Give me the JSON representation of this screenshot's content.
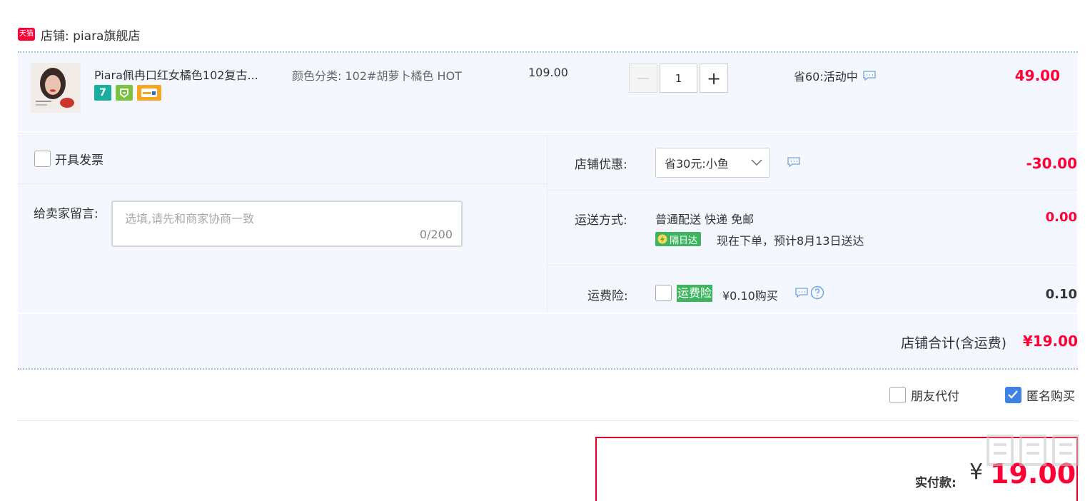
{
  "shop": {
    "logo_text": "天猫",
    "label": "店铺: piara旗舰店"
  },
  "item": {
    "title": "Piara佩冉口红女橘色102复古...",
    "sku_label": "颜色分类:",
    "sku_value": "102#胡萝卜橘色 HOT",
    "price": "109.00",
    "quantity": "1",
    "minus": "—",
    "plus": "+",
    "promo": "省60:活动中",
    "subtotal": "49.00",
    "badge_7": "7"
  },
  "invoice": {
    "label": "开具发票"
  },
  "message": {
    "label": "给卖家留言:",
    "placeholder": "选填,请先和商家协商一致",
    "counter": "0/200"
  },
  "discount": {
    "label": "店铺优惠:",
    "selected": "省30元:小鱼",
    "amount": "-30.00"
  },
  "shipping": {
    "label": "运送方式:",
    "method": "普通配送 快递 免邮",
    "tag": "隔日达",
    "eta": "现在下单，预计8月13日送达",
    "amount": "0.00"
  },
  "insurance": {
    "label": "运费险:",
    "tag": "运费险",
    "price": "¥0.10购买",
    "amount": "0.10"
  },
  "summary": {
    "label": "店铺合计(含运费)",
    "total": "¥19.00"
  },
  "options": {
    "friend_pay": "朋友代付",
    "anonymous": "匿名购买",
    "anonymous_checked": true
  },
  "payment": {
    "label": "实付款:",
    "currency": "¥",
    "amount": "19.00"
  },
  "watermark": "值 什么值得买",
  "colors": {
    "accent_red": "#ff0036",
    "panel_bg": "#f4f8fe",
    "checkbox_blue": "#3d83e6",
    "tag_green": "#3eb461"
  }
}
